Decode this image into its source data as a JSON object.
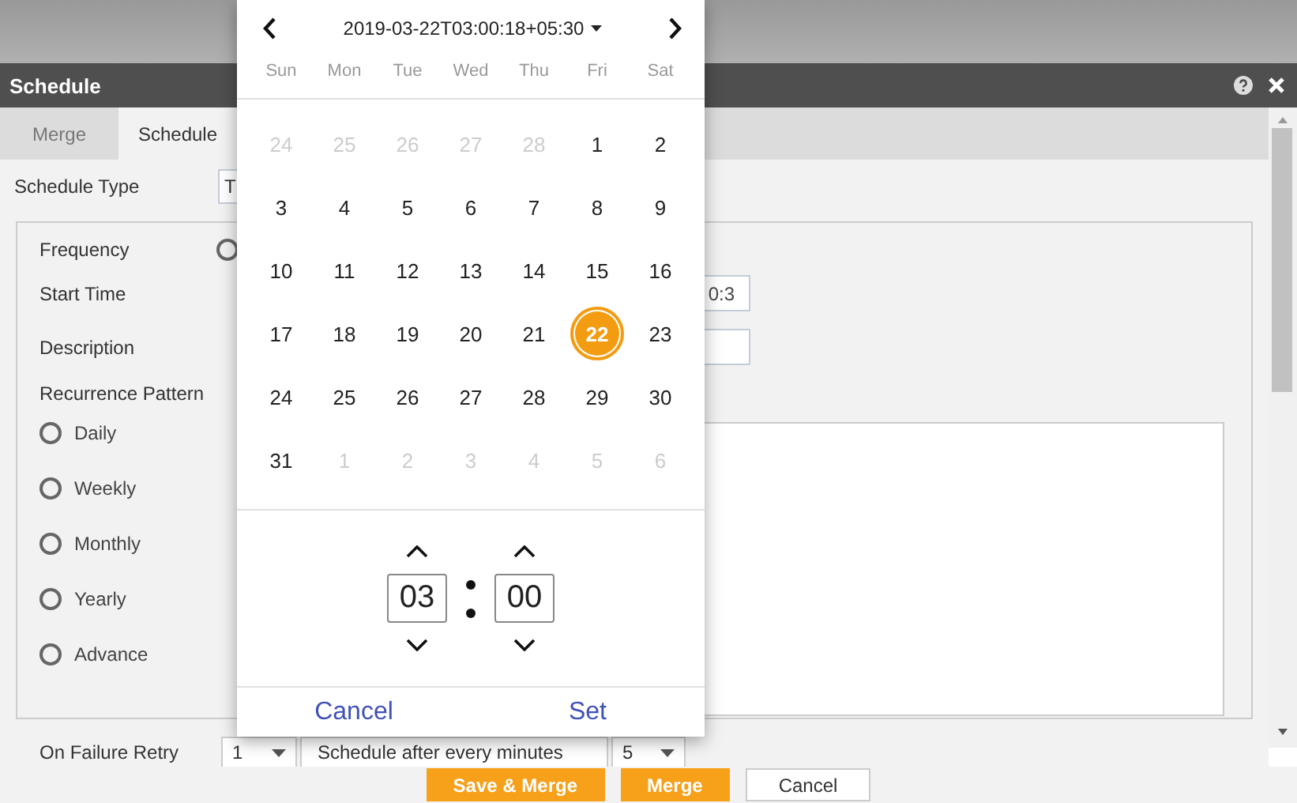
{
  "dialog": {
    "title": "Schedule"
  },
  "tabs": [
    {
      "label": "Merge",
      "selected": false
    },
    {
      "label": "Schedule",
      "selected": true
    }
  ],
  "schedule_type": {
    "label": "Schedule Type",
    "value": "T"
  },
  "frequency": {
    "label": "Frequency",
    "options": [
      {
        "selected": false
      }
    ]
  },
  "start_time": {
    "label": "Start Time",
    "value": "0:3"
  },
  "description": {
    "label": "Description"
  },
  "recurrence": {
    "label": "Recurrence Pattern",
    "options": [
      {
        "label": "Daily",
        "selected": false
      },
      {
        "label": "Weekly",
        "selected": false
      },
      {
        "label": "Monthly",
        "selected": false
      },
      {
        "label": "Yearly",
        "selected": false
      },
      {
        "label": "Advance",
        "selected": false
      }
    ]
  },
  "failure_retry": {
    "label": "On Failure Retry",
    "value": "1",
    "schedule_label": "Schedule after every minutes",
    "minutes": "5"
  },
  "buttons": [
    {
      "label": "Save & Merge",
      "kind": "primary"
    },
    {
      "label": "Merge",
      "kind": "primary"
    },
    {
      "label": "Cancel",
      "kind": "secondary"
    }
  ],
  "date_picker": {
    "title": "2019-03-22T03:00:18+05:30",
    "weekdays": [
      "Sun",
      "Mon",
      "Tue",
      "Wed",
      "Thu",
      "Fri",
      "Sat"
    ],
    "days": [
      {
        "label": "24",
        "muted": true,
        "selected": false
      },
      {
        "label": "25",
        "muted": true,
        "selected": false
      },
      {
        "label": "26",
        "muted": true,
        "selected": false
      },
      {
        "label": "27",
        "muted": true,
        "selected": false
      },
      {
        "label": "28",
        "muted": true,
        "selected": false
      },
      {
        "label": "1",
        "muted": false,
        "selected": false
      },
      {
        "label": "2",
        "muted": false,
        "selected": false
      },
      {
        "label": "3",
        "muted": false,
        "selected": false
      },
      {
        "label": "4",
        "muted": false,
        "selected": false
      },
      {
        "label": "5",
        "muted": false,
        "selected": false
      },
      {
        "label": "6",
        "muted": false,
        "selected": false
      },
      {
        "label": "7",
        "muted": false,
        "selected": false
      },
      {
        "label": "8",
        "muted": false,
        "selected": false
      },
      {
        "label": "9",
        "muted": false,
        "selected": false
      },
      {
        "label": "10",
        "muted": false,
        "selected": false
      },
      {
        "label": "11",
        "muted": false,
        "selected": false
      },
      {
        "label": "12",
        "muted": false,
        "selected": false
      },
      {
        "label": "13",
        "muted": false,
        "selected": false
      },
      {
        "label": "14",
        "muted": false,
        "selected": false
      },
      {
        "label": "15",
        "muted": false,
        "selected": false
      },
      {
        "label": "16",
        "muted": false,
        "selected": false
      },
      {
        "label": "17",
        "muted": false,
        "selected": false
      },
      {
        "label": "18",
        "muted": false,
        "selected": false
      },
      {
        "label": "19",
        "muted": false,
        "selected": false
      },
      {
        "label": "20",
        "muted": false,
        "selected": false
      },
      {
        "label": "21",
        "muted": false,
        "selected": false
      },
      {
        "label": "22",
        "muted": false,
        "selected": true
      },
      {
        "label": "23",
        "muted": false,
        "selected": false
      },
      {
        "label": "24",
        "muted": false,
        "selected": false
      },
      {
        "label": "25",
        "muted": false,
        "selected": false
      },
      {
        "label": "26",
        "muted": false,
        "selected": false
      },
      {
        "label": "27",
        "muted": false,
        "selected": false
      },
      {
        "label": "28",
        "muted": false,
        "selected": false
      },
      {
        "label": "29",
        "muted": false,
        "selected": false
      },
      {
        "label": "30",
        "muted": false,
        "selected": false
      },
      {
        "label": "31",
        "muted": false,
        "selected": false
      },
      {
        "label": "1",
        "muted": true,
        "selected": false
      },
      {
        "label": "2",
        "muted": true,
        "selected": false
      },
      {
        "label": "3",
        "muted": true,
        "selected": false
      },
      {
        "label": "4",
        "muted": true,
        "selected": false
      },
      {
        "label": "5",
        "muted": true,
        "selected": false
      },
      {
        "label": "6",
        "muted": true,
        "selected": false
      }
    ],
    "time": {
      "hours": "03",
      "minutes": "00"
    },
    "actions": [
      "Cancel",
      "Set"
    ]
  }
}
